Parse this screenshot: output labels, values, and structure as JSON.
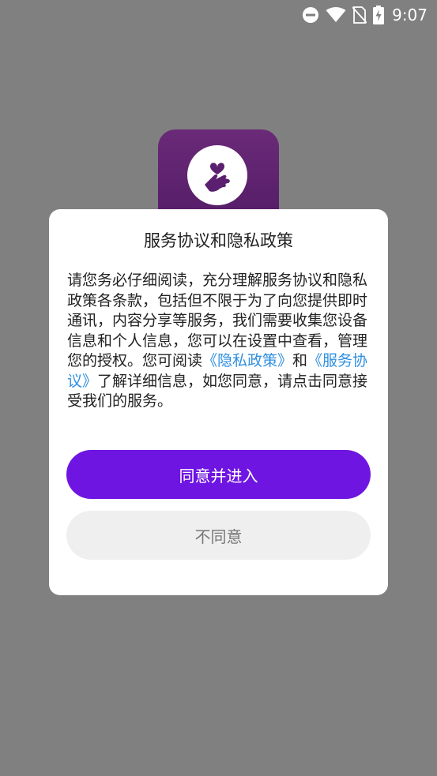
{
  "status_bar": {
    "time": "9:07",
    "icons": [
      "do-not-disturb-icon",
      "wifi-icon",
      "no-sim-icon",
      "battery-charging-icon"
    ]
  },
  "colors": {
    "overlay": "#808080",
    "primary_button": "#6f15e2",
    "secondary_button": "#efefef",
    "link": "#2f8fe0",
    "logo": "#5a1f6e"
  },
  "dialog": {
    "title": "服务协议和隐私政策",
    "body": {
      "text_1": "请您务必仔细阅读，充分理解服务协议和隐私政策各条款，包括但不限于为了向您提供即时通讯，内容分享等服务，我们需要收集您设备信息和个人信息，您可以在设置中查看，管理您的授权。您可阅读",
      "privacy_link": "《隐私政策》",
      "and": "和",
      "service_link": "《服务协议》",
      "text_2": "了解详细信息，如您同意，请点击同意接受我们的服务。"
    },
    "agree_button": "同意并进入",
    "disagree_button": "不同意"
  }
}
